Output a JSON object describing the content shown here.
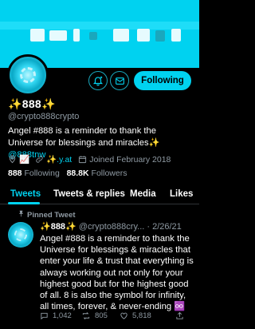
{
  "profile": {
    "display_name": "✨888✨",
    "handle": "@crypto888crypto",
    "bio_text": "Angel #888 is a reminder to thank the Universe for blessings and miracles✨",
    "bio_mention": "@888tnw",
    "location_emoji": "📈",
    "link": "✨.y.at",
    "joined": "Joined February 2018",
    "following_count": "888",
    "following_label": "Following",
    "followers_count": "88.8K",
    "followers_label": "Followers"
  },
  "actions": {
    "follow_label": "Following"
  },
  "tabs": [
    {
      "label": "Tweets"
    },
    {
      "label": "Tweets & replies"
    },
    {
      "label": "Media"
    },
    {
      "label": "Likes"
    }
  ],
  "tweet": {
    "pinned_label": "Pinned Tweet",
    "author_name": "✨888✨",
    "author_handle": "@crypto888cry...",
    "date": "· 2/26/21",
    "text": "Angel #888 is a reminder to thank the Universe for blessings & miracles that enter your life & trust that everything is always working out not only for your highest good but for the highest good of all. 8 is also the symbol for infinity, all times, forever, & never-ending ♾️",
    "reply_count": "1,042",
    "retweet_count": "805",
    "like_count": "5,818"
  },
  "colors": {
    "accent": "#00d2f0",
    "background": "#000000",
    "secondary_text": "#8f9aa3"
  }
}
